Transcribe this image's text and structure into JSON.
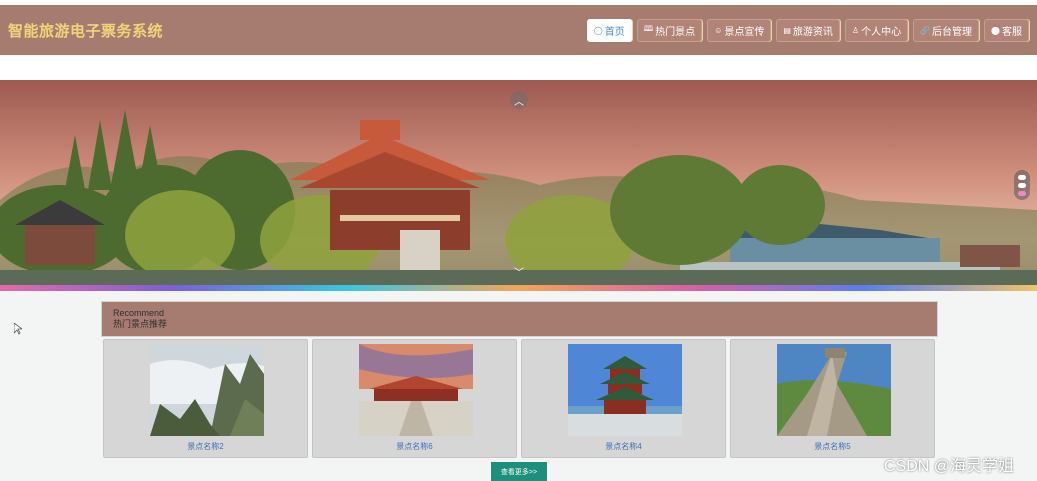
{
  "app": {
    "title": "智能旅游电子票务系统"
  },
  "nav": {
    "items": [
      {
        "label": "首页",
        "icon": "home-icon",
        "glyph": "◯",
        "active": true
      },
      {
        "label": "热门景点",
        "icon": "book-icon",
        "glyph": "🕮",
        "active": false
      },
      {
        "label": "景点宣传",
        "icon": "smile-icon",
        "glyph": "☺",
        "active": false
      },
      {
        "label": "旅游资讯",
        "icon": "list-icon",
        "glyph": "▤",
        "active": false
      },
      {
        "label": "个人中心",
        "icon": "user-icon",
        "glyph": "♙",
        "active": false
      },
      {
        "label": "后台管理",
        "icon": "link-icon",
        "glyph": "🔗",
        "active": false
      },
      {
        "label": "客服",
        "icon": "chat-icon",
        "glyph": "⬤",
        "active": false
      }
    ]
  },
  "banner": {
    "prev_icon": "chevron-up-icon",
    "next_icon": "chevron-down-icon",
    "slide_count": 3,
    "active_slide": 3
  },
  "recommend": {
    "title_en": "Recommend",
    "title_cn": "热门景点推荐",
    "cards": [
      {
        "name": "景点名称2"
      },
      {
        "name": "景点名称6"
      },
      {
        "name": "景点名称4"
      },
      {
        "name": "景点名称5"
      }
    ],
    "more_label": "查看更多>>"
  },
  "watermark": "CSDN @海灵学姐",
  "colors": {
    "header_bg": "#a67c70",
    "brand_text": "#f3d37a",
    "more_button": "#1f8f7d",
    "caption_link": "#3d6fb5"
  }
}
